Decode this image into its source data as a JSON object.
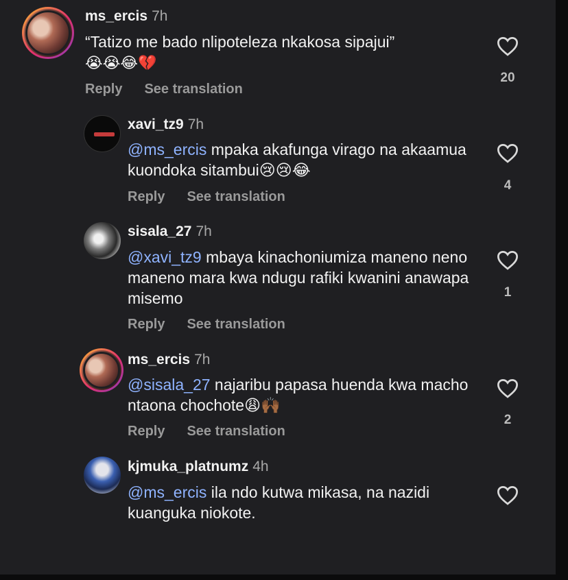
{
  "comments": [
    {
      "username": "ms_ercis",
      "time": "7h",
      "text_before": "“Tatizo me bado nlipoteleza nkakosa sipajui”",
      "emojis": "😭😭😂💔",
      "reply_label": "Reply",
      "translate_label": "See translation",
      "likes": "20"
    },
    {
      "username": "xavi_tz9",
      "time": "7h",
      "mention": "@ms_ercis",
      "text": " mpaka akafunga virago na akaamua kuondoka sitambui😢😢😂",
      "reply_label": "Reply",
      "translate_label": "See translation",
      "likes": "4"
    },
    {
      "username": "sisala_27",
      "time": "7h",
      "mention": "@xavi_tz9",
      "text": " mbaya kinachoniumiza maneno neno maneno mara kwa ndugu rafiki kwanini anawapa misemo",
      "reply_label": "Reply",
      "translate_label": "See translation",
      "likes": "1"
    },
    {
      "username": "ms_ercis",
      "time": "7h",
      "mention": "@sisala_27",
      "text": " najaribu papasa huenda kwa macho ntaona chochote😩🙌🏾",
      "reply_label": "Reply",
      "translate_label": "See translation",
      "likes": "2"
    },
    {
      "username": "kjmuka_platnumz",
      "time": "4h",
      "mention": "@ms_ercis",
      "text": " ila ndo kutwa mikasa, na nazidi kuanguka niokote."
    }
  ],
  "colors": {
    "background": "#1f1f22",
    "mention": "#8fb3ff",
    "secondary_text": "#9a9a9a"
  },
  "icons": {
    "like": "heart-outline-icon"
  }
}
